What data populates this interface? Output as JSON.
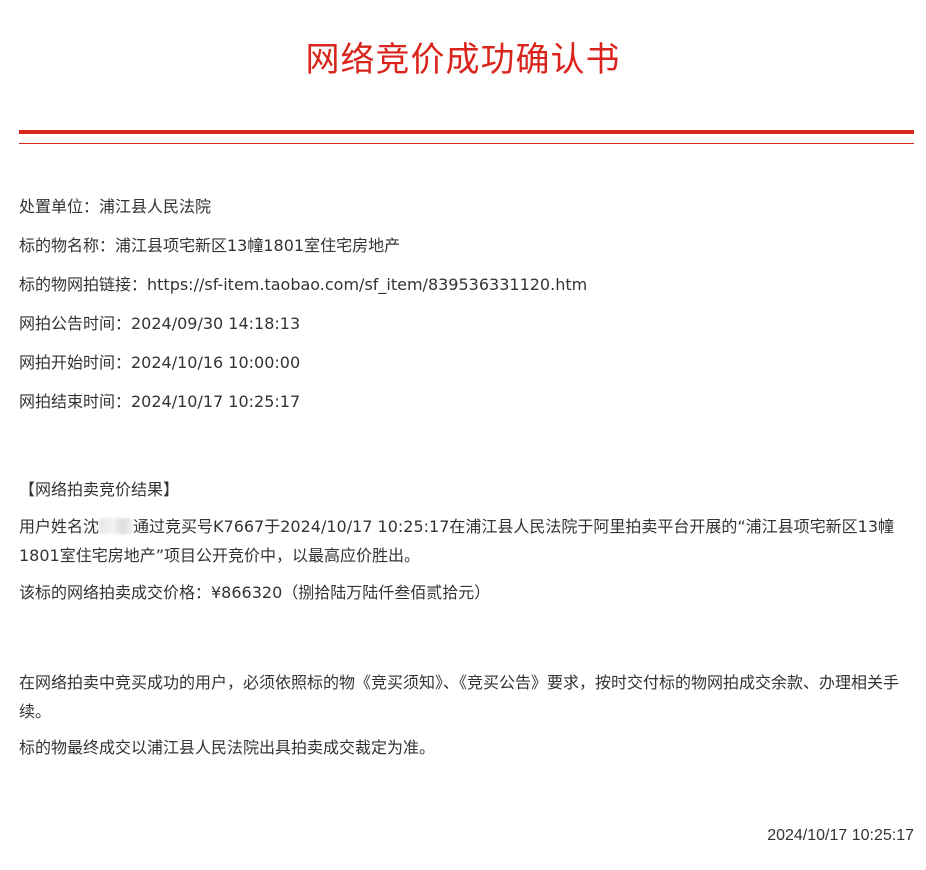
{
  "document": {
    "title": "网络竞价成功确认书",
    "accent_color": "#d9251c"
  },
  "info": {
    "disposal_unit": "处置单位：浦江县人民法院",
    "item_name": "标的物名称：浦江县项宅新区13幢1801室住宅房地产",
    "item_link": "标的物网拍链接：https://sf-item.taobao.com/sf_item/839536331120.htm",
    "announce_time": "网拍公告时间：2024/09/30 14:18:13",
    "start_time": "网拍开始时间：2024/10/16 10:00:00",
    "end_time": "网拍结束时间：2024/10/17 10:25:17"
  },
  "result": {
    "heading": "【网络拍卖竞价结果】",
    "user_prefix": "用户姓名沈",
    "user_suffix": "通过竞买号K7667于2024/10/17 10:25:17在浦江县人民法院于阿里拍卖平台开展的“浦江县项宅新区13幢1801室住宅房地产”项目公开竞价中，以最高应价胜出。",
    "price_line": "该标的网络拍卖成交价格：¥866320（捌拾陆万陆仟叁佰贰拾元）"
  },
  "notice": {
    "para1": "在网络拍卖中竞买成功的用户，必须依照标的物《竞买须知》、《竞买公告》要求，按时交付标的物网拍成交余款、办理相关手续。",
    "para2": "标的物最终成交以浦江县人民法院出具拍卖成交裁定为准。"
  },
  "footer": {
    "date": "2024/10/17 10:25:17"
  }
}
